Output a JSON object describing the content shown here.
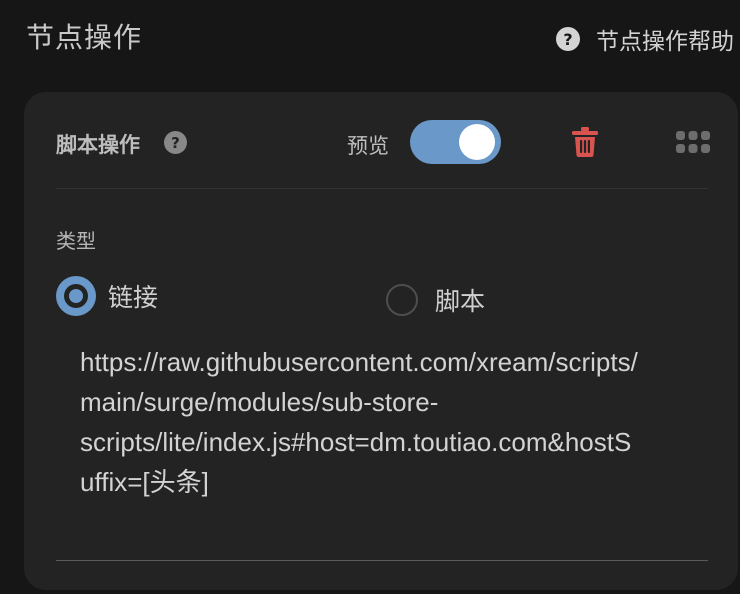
{
  "header": {
    "title": "节点操作",
    "help_label": "节点操作帮助",
    "help_icon": "question-circle-icon"
  },
  "card": {
    "title": "脚本操作",
    "help_icon": "question-circle-icon",
    "preview_label": "预览",
    "preview_enabled": true,
    "accent_color": "#6a99c9",
    "delete_color": "#d9534f",
    "type_label": "类型",
    "type_options": [
      {
        "label": "链接",
        "selected": true
      },
      {
        "label": "脚本",
        "selected": false
      }
    ],
    "content_lines": [
      "https://raw.githubusercontent.com/xream/scripts/",
      "main/surge/modules/sub-store-",
      "scripts/lite/index.js#host=dm.toutiao.com&hostS",
      "uffix=[头条]"
    ]
  }
}
